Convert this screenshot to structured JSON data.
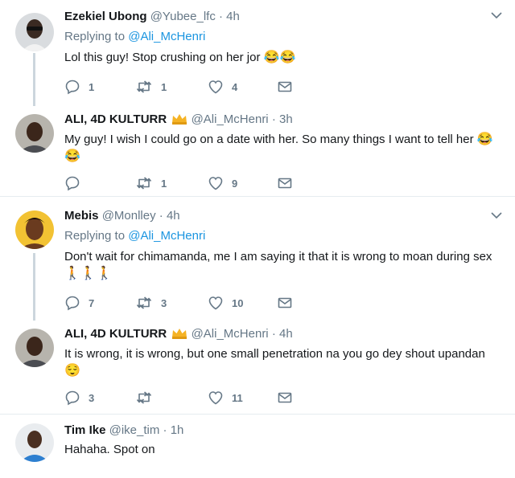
{
  "tweets": [
    {
      "name": "Ezekiel Ubong",
      "handle": "@Yubee_lfc",
      "time": "4h",
      "reply_prefix": "Replying to",
      "reply_to": "@Ali_McHenri",
      "text": "Lol this guy! Stop crushing on her jor",
      "emoji": "😂😂",
      "replies": "1",
      "retweets": "1",
      "likes": "4"
    },
    {
      "name": "ALI, 4D KULTURR",
      "handle": "@Ali_McHenri",
      "time": "3h",
      "text": "My guy! I wish I could go on a date with her. So many things I want to tell her",
      "emoji": "😂",
      "emoji2": "😂",
      "replies": "",
      "retweets": "1",
      "likes": "9"
    },
    {
      "name": "Mebis",
      "handle": "@Monlley",
      "time": "4h",
      "reply_prefix": "Replying to",
      "reply_to": "@Ali_McHenri",
      "text": "Don't wait for chimamanda, me I am saying it that it is wrong to moan during sex",
      "emoji": "🚶🚶🚶",
      "replies": "7",
      "retweets": "3",
      "likes": "10"
    },
    {
      "name": "ALI, 4D KULTURR",
      "handle": "@Ali_McHenri",
      "time": "4h",
      "text": "It is wrong, it is wrong, but one small penetration na you go dey shout upandan",
      "emoji": "😌",
      "replies": "3",
      "retweets": "",
      "likes": "11"
    },
    {
      "name": "Tim Ike",
      "handle": "@ike_tim",
      "time": "1h",
      "text": "Hahaha.  Spot on"
    }
  ],
  "dot": "·",
  "icons": [
    "reply-icon",
    "retweet-icon",
    "like-icon",
    "dm-icon",
    "caret-down-icon",
    "crown-icon"
  ],
  "colors": {
    "link": "#1b95e0",
    "muted": "#657786",
    "thread_line": "#ccd6dd",
    "divider": "#e6ecf0"
  }
}
